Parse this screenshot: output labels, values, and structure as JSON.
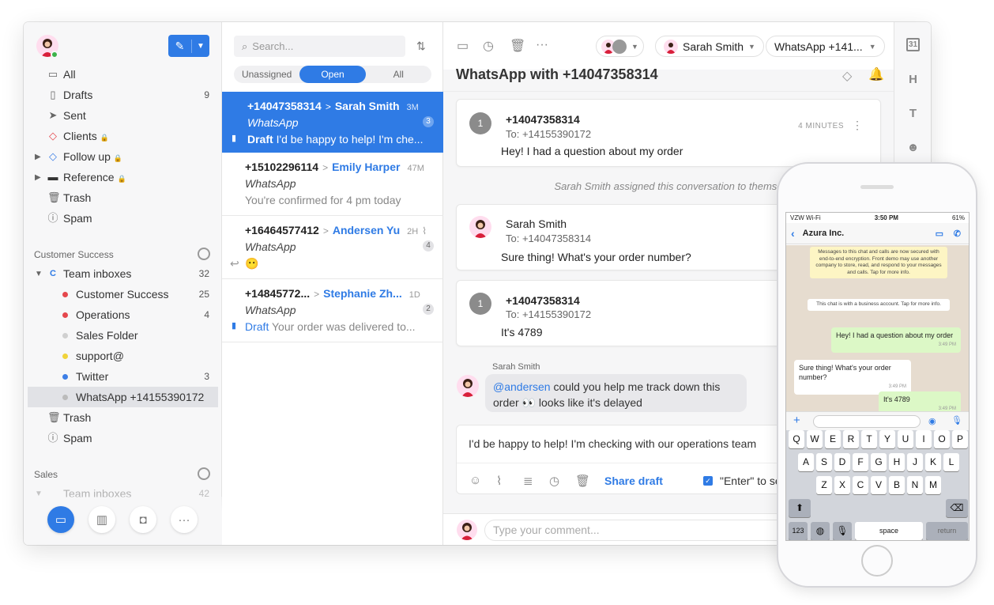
{
  "sidebar": {
    "nav": [
      {
        "label": "All",
        "icon": "inbox-icon"
      },
      {
        "label": "Drafts",
        "count": "9",
        "icon": "draft-icon"
      },
      {
        "label": "Sent",
        "icon": "send-icon"
      },
      {
        "label": "Clients",
        "icon": "tag-icon"
      },
      {
        "label": "Follow up",
        "icon": "tag-icon"
      },
      {
        "label": "Reference",
        "icon": "folder-icon"
      },
      {
        "label": "Trash",
        "icon": "trash-icon"
      },
      {
        "label": "Spam",
        "icon": "spam-icon"
      }
    ],
    "section1": "Customer Success",
    "team_inboxes": {
      "label": "Team inboxes",
      "count": "32"
    },
    "inboxes": [
      {
        "label": "Customer Success",
        "count": "25",
        "color": "#e5484d"
      },
      {
        "label": "Operations",
        "count": "4",
        "color": "#e5484d"
      },
      {
        "label": "Sales Folder",
        "count": "",
        "color": "#d0d0d0"
      },
      {
        "label": "support@",
        "count": "",
        "color": "#f0d33a"
      },
      {
        "label": "Twitter",
        "count": "3",
        "color": "#3d7fe6"
      },
      {
        "label": "WhatsApp +14155390172",
        "count": "",
        "color": "#bbbbbb"
      }
    ],
    "team_trash": "Trash",
    "team_spam": "Spam",
    "section2": "Sales",
    "sales_team_inboxes": "Team inboxes",
    "sales_count": "42"
  },
  "list": {
    "search_placeholder": "Search...",
    "tabs": [
      "Unassigned",
      "Open",
      "All"
    ],
    "items": [
      {
        "from": "+14047358314",
        "to": "Sarah Smith",
        "time": "3M",
        "channel": "WhatsApp",
        "draft_label": "Draft",
        "preview": "I'd be happy to help! I'm che...",
        "badge": "3"
      },
      {
        "from": "+15102296114",
        "to": "Emily Harper",
        "time": "47M",
        "channel": "WhatsApp",
        "preview": "You're confirmed for 4 pm today",
        "badge": ""
      },
      {
        "from": "+16464577412",
        "to": "Andersen Yu",
        "time": "2H",
        "channel": "WhatsApp",
        "preview": "😶",
        "badge": "4"
      },
      {
        "from": "+14845772...",
        "to": "Stephanie Zh...",
        "time": "1D",
        "channel": "WhatsApp",
        "draft_label": "Draft",
        "preview": "Your order was delivered to...",
        "badge": "2"
      }
    ]
  },
  "main": {
    "assignee": "Sarah Smith",
    "channel": "WhatsApp +141...",
    "title": "WhatsApp with +14047358314",
    "messages": [
      {
        "avatar": "1",
        "from": "+14047358314",
        "to": "To: +14155390172",
        "time": "4 MINUTES",
        "body": "Hey! I had a question about my order"
      },
      {
        "from": "Sarah Smith",
        "to": "To: +14047358314",
        "body": "Sure thing! What's your order number?"
      },
      {
        "avatar": "1",
        "from": "+14047358314",
        "to": "To: +14155390172",
        "body": "It's 4789"
      }
    ],
    "system": "Sarah Smith assigned this conversation to themse",
    "comment": {
      "author": "Sarah Smith",
      "mention": "@andersen",
      "text1": " could you help me track down this",
      "text2": "order 👀 looks like it's delayed"
    },
    "draft_text": "I'd be happy to help! I'm checking with our operations team",
    "share": "Share draft",
    "enter": "\"Enter\" to se",
    "comment_placeholder": "Type your comment..."
  },
  "rail": {
    "calendar": "31",
    "h": "H",
    "t": "T"
  },
  "phone": {
    "carrier": "VZW Wi-Fi",
    "clock": "3:50 PM",
    "battery": "61%",
    "contact": "Azura Inc.",
    "notice": "Messages to this chat and calls are now secured with end-to-end encryption. Front demo may use another company to store, read, and respond to your messages and calls. Tap for more info.",
    "business": "This chat is with a business account. Tap for more info.",
    "msg1": "Hey! I had a question about my order",
    "t1": "3:49 PM",
    "msg2": "Sure thing! What's your order number?",
    "t2": "3:49 PM",
    "msg3": "It's 4789",
    "t3": "3:49 PM",
    "row1": [
      "Q",
      "W",
      "E",
      "R",
      "T",
      "Y",
      "U",
      "I",
      "O",
      "P"
    ],
    "row2": [
      "A",
      "S",
      "D",
      "F",
      "G",
      "H",
      "J",
      "K",
      "L"
    ],
    "row3": [
      "Z",
      "X",
      "C",
      "V",
      "B",
      "N",
      "M"
    ],
    "k123": "123",
    "space": "space",
    "ret": "return"
  }
}
